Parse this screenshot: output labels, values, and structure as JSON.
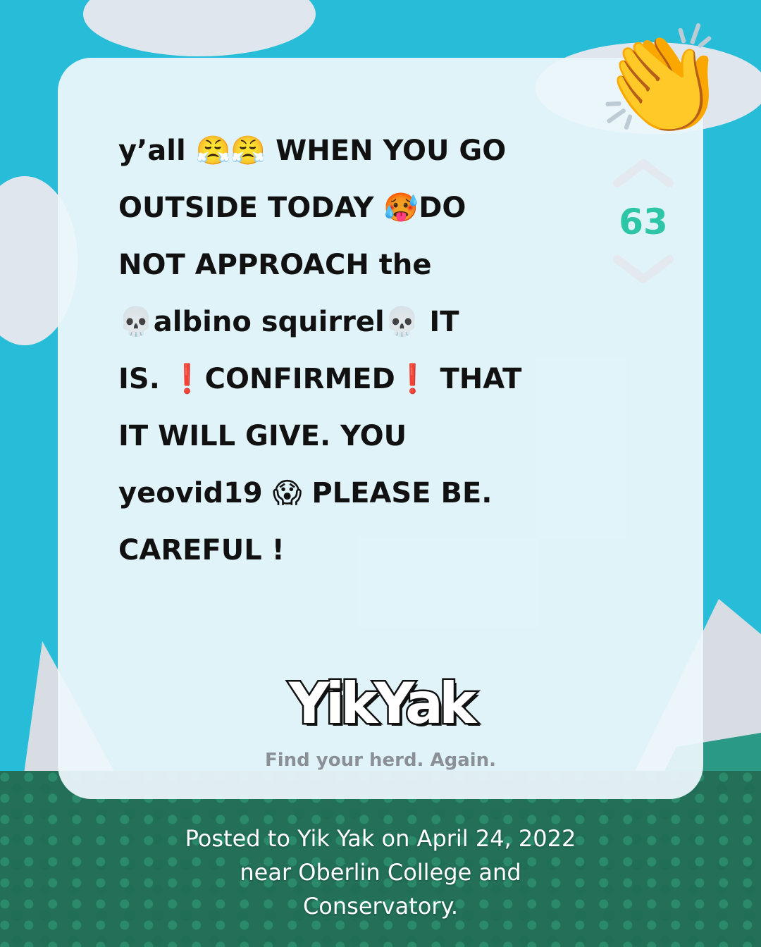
{
  "post": {
    "text": "y’all 😤😤 WHEN YOU GO\nOUTSIDE TODAY 🥵DO\nNOT APPROACH the\n💀albino squirrel💀 IT\nIS. ❗CONFIRMED❗ THAT\nIT WILL GIVE. YOU\nyeovid19 😱 PLEASE BE.\nCAREFUL !"
  },
  "votes": {
    "score": "63",
    "up_icon": "chevron-up-icon",
    "down_icon": "chevron-down-icon"
  },
  "reaction_icon": "👏",
  "brand": {
    "logo_text": "YikYak",
    "tagline": "Find your herd. Again."
  },
  "caption": {
    "line1": "Posted to Yik Yak on April 24, 2022",
    "line2": "near Oberlin College and",
    "line3": "Conservatory."
  },
  "colors": {
    "background": "#27bcd8",
    "card": "#ecf7fb",
    "score": "#2cc6a6",
    "chevron": "#e3e9ee",
    "tagline": "#8a9095",
    "caption": "#ffffff"
  }
}
